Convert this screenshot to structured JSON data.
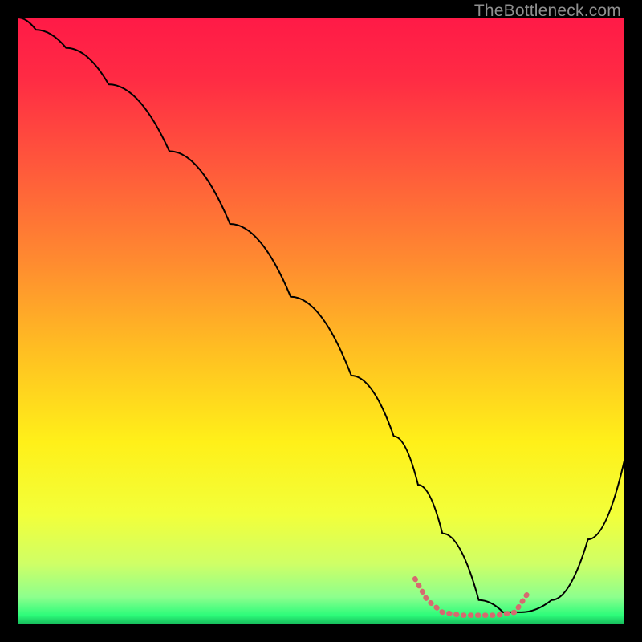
{
  "watermark": {
    "text": "TheBottleneck.com"
  },
  "chart_data": {
    "type": "line",
    "title": "",
    "xlabel": "",
    "ylabel": "",
    "xlim": [
      0,
      100
    ],
    "ylim": [
      0,
      100
    ],
    "grid": false,
    "background_gradient": {
      "stops": [
        {
          "pos": 0.0,
          "color": "#ff1a47"
        },
        {
          "pos": 0.1,
          "color": "#ff2b44"
        },
        {
          "pos": 0.25,
          "color": "#ff5a3b"
        },
        {
          "pos": 0.4,
          "color": "#ff8a30"
        },
        {
          "pos": 0.55,
          "color": "#ffbf22"
        },
        {
          "pos": 0.7,
          "color": "#fff019"
        },
        {
          "pos": 0.82,
          "color": "#f2ff3a"
        },
        {
          "pos": 0.9,
          "color": "#cfff66"
        },
        {
          "pos": 0.955,
          "color": "#8dff8d"
        },
        {
          "pos": 0.985,
          "color": "#2dfc7a"
        },
        {
          "pos": 1.0,
          "color": "#16b85a"
        }
      ]
    },
    "series": [
      {
        "name": "bottleneck-curve",
        "stroke": "#000000",
        "stroke_width": 2,
        "x": [
          0,
          3,
          8,
          15,
          25,
          35,
          45,
          55,
          62,
          66,
          70,
          76,
          80,
          83,
          88,
          94,
          100
        ],
        "values": [
          100,
          98,
          95,
          89,
          78,
          66,
          54,
          41,
          31,
          23,
          15,
          4,
          2,
          2,
          4,
          14,
          27
        ]
      },
      {
        "name": "optimal-range-marker",
        "stroke": "#d66a6f",
        "stroke_width": 6.5,
        "dash": [
          1,
          8
        ],
        "x": [
          65.5,
          67.5,
          70,
          73,
          76,
          79,
          82,
          84
        ],
        "values": [
          7.5,
          4.0,
          2.0,
          1.5,
          1.5,
          1.5,
          2.0,
          5.0
        ]
      }
    ]
  }
}
